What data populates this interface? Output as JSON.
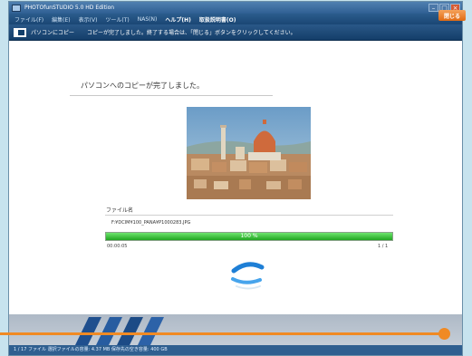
{
  "window": {
    "title": "PHOTOfunSTUDIO 5.0 HD Edition"
  },
  "menubar": {
    "items": [
      {
        "label": "ファイル(F)",
        "bold": false
      },
      {
        "label": "編集(E)",
        "bold": false
      },
      {
        "label": "表示(V)",
        "bold": false
      },
      {
        "label": "ツール(T)",
        "bold": false
      },
      {
        "label": "NAS(N)",
        "bold": false
      },
      {
        "label": "ヘルプ(H)",
        "bold": true
      },
      {
        "label": "取扱説明書(O)",
        "bold": true
      }
    ]
  },
  "header": {
    "title": "パソコンにコピー",
    "message": "コピーが完了しました。終了する場合は、「閉じる」ボタンをクリックしてください。"
  },
  "content": {
    "done_message": "パソコンへのコピーが完了しました。",
    "file_label": "ファイル名",
    "file_path": "F:¥DCIM¥100_PANA¥P1000283.JPG",
    "progress": {
      "label": "100 %",
      "fraction": 1.0
    },
    "elapsed": "00:00:05",
    "count": "1 / 1"
  },
  "footer": {
    "close_label": "閉じる",
    "status": "1 / 17 ファイル 選択ファイルの容量: 4.37 MB 保存先の空き容量: 400 GB"
  },
  "colors": {
    "accent_orange": "#f08a24",
    "progress_green": "#1fa51f",
    "titlebar_blue": "#2f5f93"
  }
}
